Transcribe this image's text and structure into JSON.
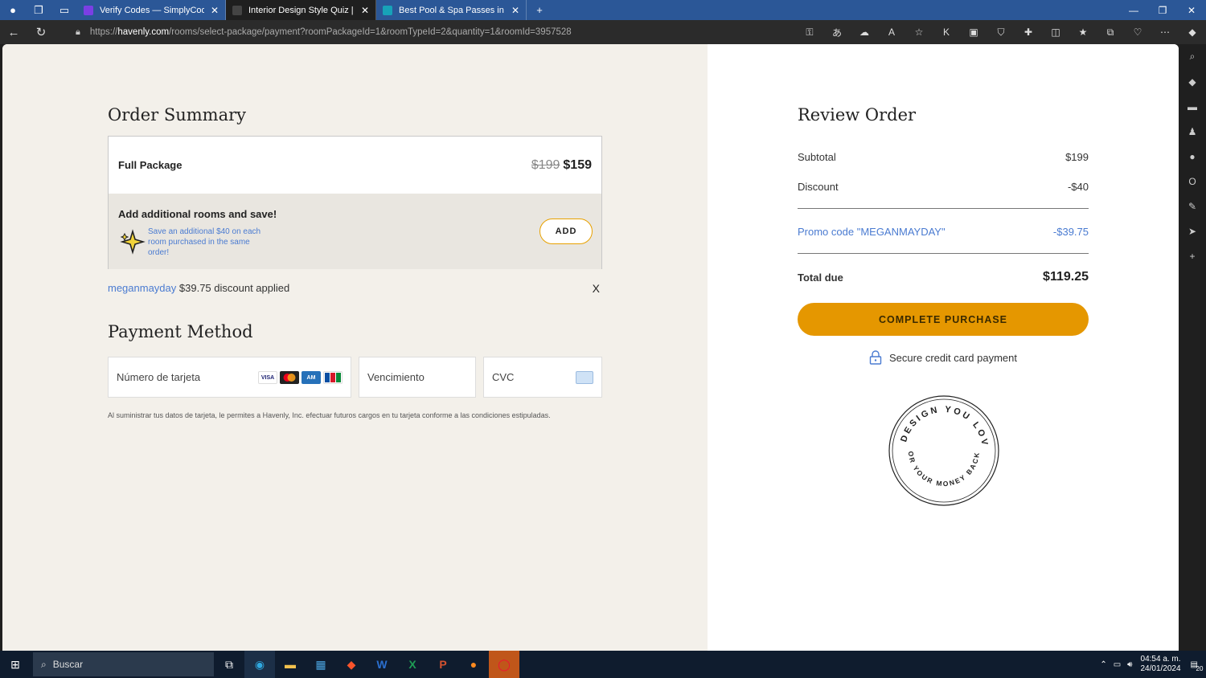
{
  "browser": {
    "tabs": [
      {
        "label": "Verify Codes — SimplyCodes",
        "color": "#7b3fe4"
      },
      {
        "label": "Interior Design Style Quiz | Desig",
        "color": "#555555"
      },
      {
        "label": "Best Pool & Spa Passes in Phoen",
        "color": "#17a2b8"
      }
    ],
    "url_prefix": "https://",
    "url_domain": "havenly.com",
    "url_rest": "/rooms/select-package/payment?roomPackageId=1&roomTypeId=2&quantity=1&roomId=3957528"
  },
  "order_summary": {
    "heading": "Order Summary",
    "package_name": "Full Package",
    "old_price": "$199",
    "price": "$159",
    "upsell_title": "Add additional rooms and save!",
    "upsell_desc": "Save an additional $40 on each room purchased in the same order!",
    "add_label": "ADD",
    "promo_code": "meganmayday",
    "promo_text": " $39.75 discount applied",
    "remove_label": "X"
  },
  "payment": {
    "heading": "Payment Method",
    "card_placeholder": "Número de tarjeta",
    "expiry_placeholder": "Vencimiento",
    "cvc_placeholder": "CVC",
    "legal": "Al suministrar tus datos de tarjeta, le permites a Havenly, Inc. efectuar futuros cargos en tu tarjeta conforme a las condiciones estipuladas."
  },
  "review": {
    "heading": "Review Order",
    "subtotal_label": "Subtotal",
    "subtotal": "$199",
    "discount_label": "Discount",
    "discount": "-$40",
    "promo_label": "Promo code \"MEGANMAYDAY\"",
    "promo_value": "-$39.75",
    "total_label": "Total due",
    "total": "$119.25",
    "cta": "COMPLETE PURCHASE",
    "secure": "Secure credit card payment",
    "badge_top": "A DESIGN YOU LOVE",
    "badge_bottom": "OR YOUR MONEY BACK"
  },
  "taskbar": {
    "search": "Buscar",
    "time": "04:54 a. m.",
    "date": "24/01/2024",
    "notifications": "20"
  },
  "colors": {
    "accent": "#e59700",
    "link": "#4a7bd1"
  }
}
